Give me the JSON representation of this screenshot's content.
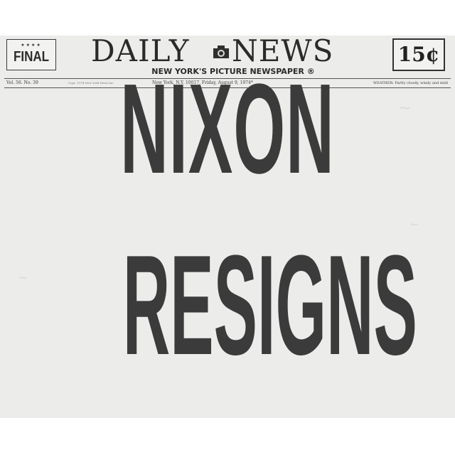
{
  "masthead": {
    "final_label": "FINAL",
    "final_stars": "★★★★",
    "title_word1": "DAILY",
    "title_word2": "NEWS",
    "subtitle": "NEW YORK'S PICTURE NEWSPAPER ®",
    "price": "15¢",
    "logo_icon": "camera-icon"
  },
  "dateline": {
    "volume": "Vol. 56. No. 39",
    "small_print": "Copr. 1974 New York News Inc.",
    "place_date": "New York, N.Y. 10017, Friday, August 9, 1974*",
    "weather": "WEATHER: Partly cloudy, windy and mild"
  },
  "headline": {
    "line1": "NIXON",
    "line2": "RESIGNS"
  },
  "colors": {
    "paper": "#ececea",
    "ink": "#3b3b3b"
  }
}
